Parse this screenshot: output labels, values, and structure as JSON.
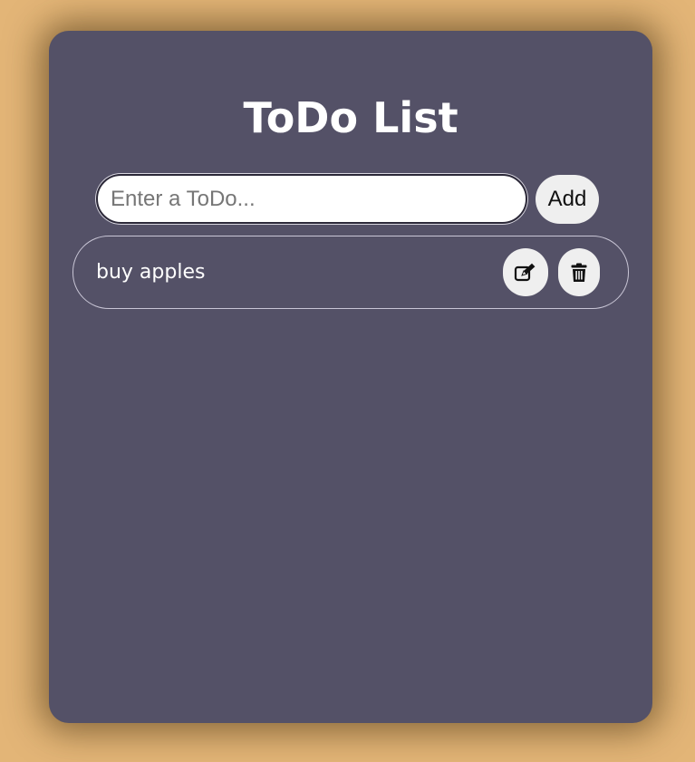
{
  "app": {
    "title": "ToDo List"
  },
  "input": {
    "placeholder": "Enter a ToDo...",
    "value": ""
  },
  "add_button": {
    "label": "Add"
  },
  "todos": [
    {
      "text": "buy apples",
      "edit_icon": "edit-icon",
      "delete_icon": "trash-icon"
    }
  ],
  "colors": {
    "page_background": "#e3b577",
    "card_background": "#545167",
    "button_background": "#efefef",
    "text": "#ffffff"
  }
}
